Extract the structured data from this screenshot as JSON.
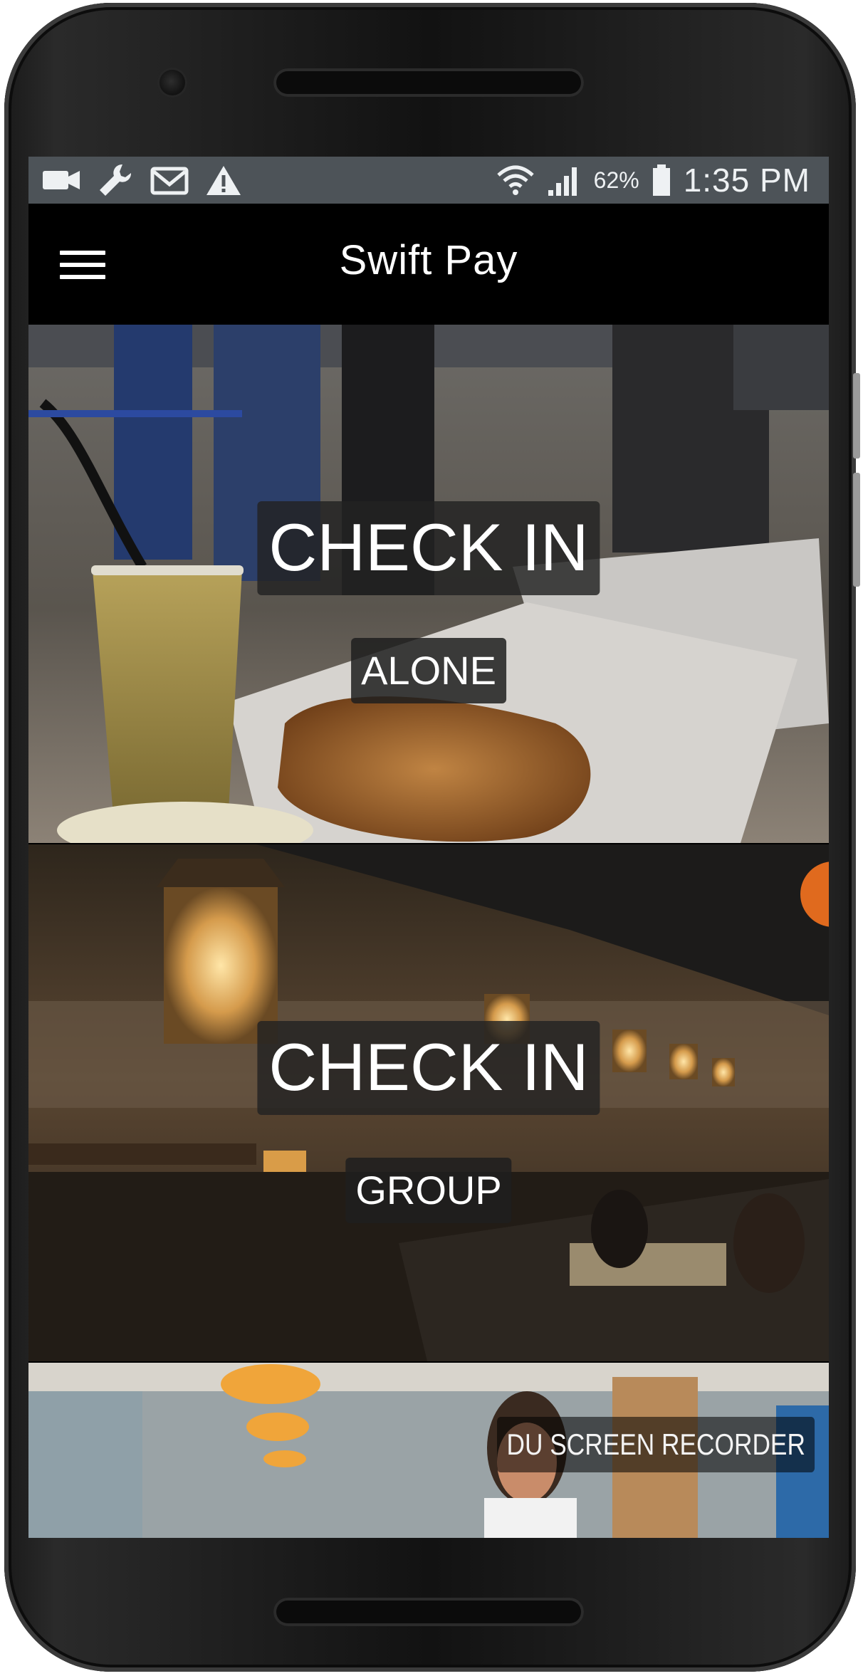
{
  "status_bar": {
    "icons": [
      "video-camera-icon",
      "wrench-icon",
      "gmail-icon",
      "warning-icon",
      "wifi-icon",
      "cell-signal-icon",
      "battery-icon"
    ],
    "battery_percent": "62%",
    "time": "1:35 PM"
  },
  "app_bar": {
    "menu_icon": "hamburger-menu-icon",
    "title": "Swift Pay"
  },
  "cards": [
    {
      "title": "CHECK IN",
      "subtitle": "ALONE"
    },
    {
      "title": "CHECK IN",
      "subtitle": "GROUP"
    }
  ],
  "watermark": "DU SCREEN RECORDER",
  "colors": {
    "status_bar_bg": "#4d5358",
    "app_bar_bg": "#000000",
    "label_bg": "#222222",
    "label_text": "#ffffff"
  }
}
